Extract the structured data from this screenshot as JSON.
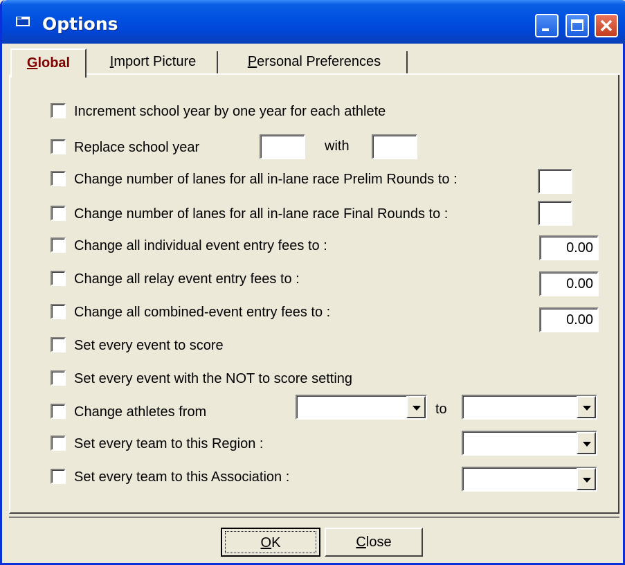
{
  "window": {
    "title": "Options"
  },
  "tabs": [
    {
      "label": "Global",
      "mnemonic": "G",
      "rest": "lobal"
    },
    {
      "label": "Import Picture",
      "mnemonic": "I",
      "rest": "mport Picture"
    },
    {
      "label": "Personal Preferences",
      "mnemonic": "P",
      "rest": "ersonal Preferences"
    }
  ],
  "options": {
    "increment_year": {
      "label": "Increment school year by one year for each athlete",
      "checked": false
    },
    "replace_year": {
      "label": "Replace school year",
      "with_label": "with",
      "from_value": "",
      "to_value": ""
    },
    "prelim_lanes": {
      "label": "Change number of lanes for all in-lane race Prelim Rounds to :",
      "value": ""
    },
    "final_lanes": {
      "label": "Change number of lanes for all in-lane race Final Rounds to :",
      "value": ""
    },
    "indiv_fee": {
      "label": "Change all individual event entry fees to :",
      "value": "0.00"
    },
    "relay_fee": {
      "label": "Change all relay event entry fees to :",
      "value": "0.00"
    },
    "combined_fee": {
      "label": "Change all combined-event entry fees to :",
      "value": "0.00"
    },
    "score_all": {
      "label": "Set every event to score"
    },
    "not_score": {
      "label": "Set every event with the NOT to score setting"
    },
    "athletes_from": {
      "label": "Change athletes from",
      "to_label": "to",
      "from_value": "",
      "to_value": ""
    },
    "region": {
      "label": "Set every team to this Region :",
      "value": ""
    },
    "association": {
      "label": "Set every team to this Association :",
      "value": ""
    }
  },
  "buttons": {
    "ok": {
      "mnemonic": "O",
      "rest": "K"
    },
    "close": {
      "mnemonic": "C",
      "rest": "lose"
    }
  },
  "colors": {
    "titlebar": "#0050e0",
    "face": "#ece9d8",
    "active_tab_text": "#800000"
  }
}
